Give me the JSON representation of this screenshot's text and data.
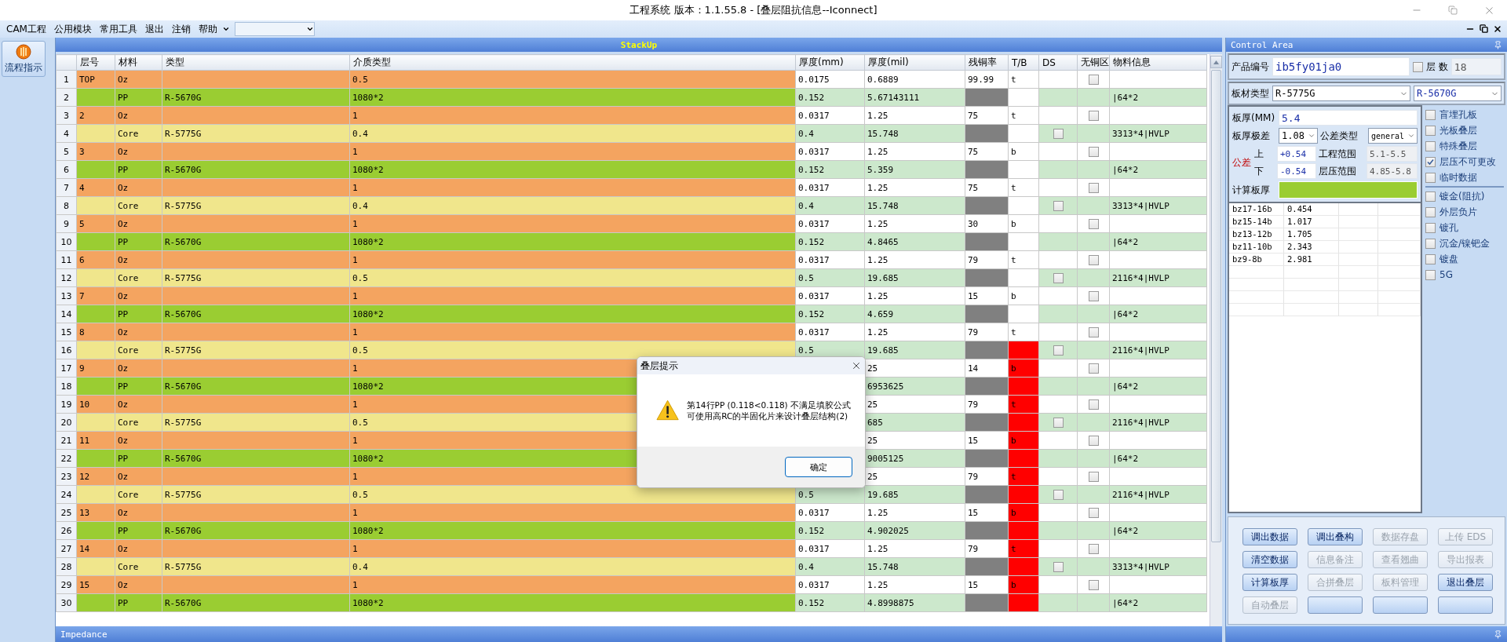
{
  "window": {
    "title": "工程系统   版本：1.1.55.8 - [叠层阻抗信息--Iconnect]"
  },
  "menu": {
    "items": [
      "CAM工程",
      "公用模块",
      "常用工具",
      "退出",
      "注销",
      "帮助"
    ]
  },
  "sidebar": {
    "items": [
      {
        "label": "流程指示",
        "selected": true
      }
    ]
  },
  "stackup": {
    "title": "StackUp",
    "columns": [
      "层号",
      "材料",
      "类型",
      "介质类型",
      "厚度(mm)",
      "厚度(mil)",
      "残铜率",
      "T/B",
      "DS",
      "无铜区",
      "物料信息"
    ],
    "rows": [
      {
        "n": "1",
        "kind": "copper",
        "layer": "TOP",
        "material": "Oz",
        "dielectric": "0.5",
        "mm": "0.0175",
        "mil": "0.6889",
        "cu": "99.99",
        "tb": "t",
        "tb_error": false,
        "cu_free": false
      },
      {
        "n": "2",
        "kind": "prepreg",
        "material": "PP",
        "type": "R-5670G",
        "dielectric": "1080*2",
        "mm": "0.152",
        "mil": "5.67143111",
        "tb_error": false,
        "info": "|64*2"
      },
      {
        "n": "3",
        "kind": "copper",
        "layer": "2",
        "material": "Oz",
        "dielectric": "1",
        "mm": "0.0317",
        "mil": "1.25",
        "cu": "75",
        "tb": "t",
        "tb_error": false,
        "cu_free": false
      },
      {
        "n": "4",
        "kind": "core",
        "material": "Core",
        "type": "R-5775G",
        "dielectric": "0.4",
        "mm": "0.4",
        "mil": "15.748",
        "tb_error": false,
        "ds": false,
        "info": "3313*4|HVLP"
      },
      {
        "n": "5",
        "kind": "copper",
        "layer": "3",
        "material": "Oz",
        "dielectric": "1",
        "mm": "0.0317",
        "mil": "1.25",
        "cu": "75",
        "tb": "b",
        "tb_error": false,
        "cu_free": false
      },
      {
        "n": "6",
        "kind": "prepreg",
        "material": "PP",
        "type": "R-5670G",
        "dielectric": "1080*2",
        "mm": "0.152",
        "mil": "5.359",
        "tb_error": false,
        "info": "|64*2"
      },
      {
        "n": "7",
        "kind": "copper",
        "layer": "4",
        "material": "Oz",
        "dielectric": "1",
        "mm": "0.0317",
        "mil": "1.25",
        "cu": "75",
        "tb": "t",
        "tb_error": false,
        "cu_free": false
      },
      {
        "n": "8",
        "kind": "core",
        "material": "Core",
        "type": "R-5775G",
        "dielectric": "0.4",
        "mm": "0.4",
        "mil": "15.748",
        "tb_error": false,
        "ds": false,
        "info": "3313*4|HVLP"
      },
      {
        "n": "9",
        "kind": "copper",
        "layer": "5",
        "material": "Oz",
        "dielectric": "1",
        "mm": "0.0317",
        "mil": "1.25",
        "cu": "30",
        "tb": "b",
        "tb_error": false,
        "cu_free": false
      },
      {
        "n": "10",
        "kind": "prepreg",
        "material": "PP",
        "type": "R-5670G",
        "dielectric": "1080*2",
        "mm": "0.152",
        "mil": "4.8465",
        "tb_error": false,
        "info": "|64*2"
      },
      {
        "n": "11",
        "kind": "copper",
        "layer": "6",
        "material": "Oz",
        "dielectric": "1",
        "mm": "0.0317",
        "mil": "1.25",
        "cu": "79",
        "tb": "t",
        "tb_error": false,
        "cu_free": false
      },
      {
        "n": "12",
        "kind": "core",
        "material": "Core",
        "type": "R-5775G",
        "dielectric": "0.5",
        "mm": "0.5",
        "mil": "19.685",
        "tb_error": false,
        "ds": false,
        "info": "2116*4|HVLP"
      },
      {
        "n": "13",
        "kind": "copper",
        "layer": "7",
        "material": "Oz",
        "dielectric": "1",
        "mm": "0.0317",
        "mil": "1.25",
        "cu": "15",
        "tb": "b",
        "tb_error": false,
        "cu_free": false
      },
      {
        "n": "14",
        "kind": "prepreg",
        "material": "PP",
        "type": "R-5670G",
        "dielectric": "1080*2",
        "mm": "0.152",
        "mil": "4.659",
        "tb_error": false,
        "info": "|64*2"
      },
      {
        "n": "15",
        "kind": "copper",
        "layer": "8",
        "material": "Oz",
        "dielectric": "1",
        "mm": "0.0317",
        "mil": "1.25",
        "cu": "79",
        "tb": "t",
        "tb_error": false,
        "cu_free": false
      },
      {
        "n": "16",
        "kind": "core",
        "material": "Core",
        "type": "R-5775G",
        "dielectric": "0.5",
        "mm": "0.5",
        "mil": "19.685",
        "tb_error": true,
        "ds": false,
        "info": "2116*4|HVLP"
      },
      {
        "n": "17",
        "kind": "copper",
        "layer": "9",
        "material": "Oz",
        "dielectric": "1",
        "mil": "25",
        "cu": "14",
        "tb": "b",
        "tb_error": true,
        "cu_free": false
      },
      {
        "n": "18",
        "kind": "prepreg",
        "material": "PP",
        "type": "R-5670G",
        "dielectric": "1080*2",
        "mil": "6953625",
        "tb_error": true,
        "info": "|64*2"
      },
      {
        "n": "19",
        "kind": "copper",
        "layer": "10",
        "material": "Oz",
        "dielectric": "1",
        "mil": "25",
        "cu": "79",
        "tb": "t",
        "tb_error": true,
        "cu_free": false
      },
      {
        "n": "20",
        "kind": "core",
        "material": "Core",
        "type": "R-5775G",
        "dielectric": "0.5",
        "mil": "685",
        "tb_error": true,
        "ds": false,
        "info": "2116*4|HVLP"
      },
      {
        "n": "21",
        "kind": "copper",
        "layer": "11",
        "material": "Oz",
        "dielectric": "1",
        "mil": "25",
        "cu": "15",
        "tb": "b",
        "tb_error": true,
        "cu_free": false
      },
      {
        "n": "22",
        "kind": "prepreg",
        "material": "PP",
        "type": "R-5670G",
        "dielectric": "1080*2",
        "mil": "9005125",
        "tb_error": true,
        "info": "|64*2"
      },
      {
        "n": "23",
        "kind": "copper",
        "layer": "12",
        "material": "Oz",
        "dielectric": "1",
        "mil": "25",
        "cu": "79",
        "tb": "t",
        "tb_error": true,
        "cu_free": false
      },
      {
        "n": "24",
        "kind": "core",
        "material": "Core",
        "type": "R-5775G",
        "dielectric": "0.5",
        "mm": "0.5",
        "mil": "19.685",
        "tb_error": true,
        "ds": false,
        "info": "2116*4|HVLP"
      },
      {
        "n": "25",
        "kind": "copper",
        "layer": "13",
        "material": "Oz",
        "dielectric": "1",
        "mm": "0.0317",
        "mil": "1.25",
        "cu": "15",
        "tb": "b",
        "tb_error": true,
        "cu_free": false
      },
      {
        "n": "26",
        "kind": "prepreg",
        "material": "PP",
        "type": "R-5670G",
        "dielectric": "1080*2",
        "mm": "0.152",
        "mil": "4.902025",
        "tb_error": true,
        "info": "|64*2"
      },
      {
        "n": "27",
        "kind": "copper",
        "layer": "14",
        "material": "Oz",
        "dielectric": "1",
        "mm": "0.0317",
        "mil": "1.25",
        "cu": "79",
        "tb": "t",
        "tb_error": true,
        "cu_free": false
      },
      {
        "n": "28",
        "kind": "core",
        "material": "Core",
        "type": "R-5775G",
        "dielectric": "0.4",
        "mm": "0.4",
        "mil": "15.748",
        "tb_error": true,
        "ds": false,
        "info": "3313*4|HVLP"
      },
      {
        "n": "29",
        "kind": "copper",
        "layer": "15",
        "material": "Oz",
        "dielectric": "1",
        "mm": "0.0317",
        "mil": "1.25",
        "cu": "15",
        "tb": "b",
        "tb_error": true,
        "cu_free": false
      },
      {
        "n": "30",
        "kind": "prepreg",
        "material": "PP",
        "type": "R-5670G",
        "dielectric": "1080*2",
        "mm": "0.152",
        "mil": "4.8998875",
        "tb_error": true,
        "info": "|64*2"
      }
    ]
  },
  "dialog": {
    "title": "叠层提示",
    "message": [
      "第14行PP (0.118<0.118) 不满足填胶公式",
      "可使用高RC的半固化片来设计叠层结构(2)"
    ],
    "button": "确定"
  },
  "impedance": {
    "title": "Impedance"
  },
  "control_area": {
    "title": "Control Area",
    "product_no": {
      "label": "产品编号",
      "value": "ib5fy01ja0"
    },
    "layer_count": {
      "label": "层 数",
      "checked": false,
      "value": "18"
    },
    "material": {
      "label": "板材类型",
      "core": "R-5775G",
      "prepreg": "R-5670G"
    },
    "thickness": {
      "label": "板厚(MM)",
      "value": "5.4"
    },
    "thickness_range": {
      "label": "板厚极差",
      "value": "1.08"
    },
    "tolerance_type": {
      "label": "公差类型",
      "value": "general"
    },
    "tolerance": {
      "label": "公差",
      "upper_label": "上",
      "upper": "+0.54",
      "lower_label": "下",
      "lower": "-0.54"
    },
    "eng_range": {
      "label": "工程范围",
      "value": "5.1-5.5"
    },
    "press_range": {
      "label": "层压范围",
      "value": "4.85-5.8"
    },
    "calc": {
      "label": "计算板厚"
    },
    "options": [
      [
        {
          "label": "盲埋孔板",
          "checked": false
        },
        {
          "label": "光板叠层",
          "checked": false
        },
        {
          "label": "特殊叠层",
          "checked": false
        },
        {
          "label": "层压不可更改",
          "checked": true
        },
        {
          "label": "临时数据",
          "checked": false
        }
      ],
      [
        {
          "label": "镀金(阻抗)",
          "checked": false
        },
        {
          "label": "外层负片",
          "checked": false
        },
        {
          "label": "镀孔",
          "checked": false
        },
        {
          "label": "沉金/镍钯金",
          "checked": false
        },
        {
          "label": "镀盘",
          "checked": false
        },
        {
          "label": "5G",
          "checked": false
        }
      ]
    ],
    "results": [
      {
        "name": "bz17-16b",
        "value": "0.454"
      },
      {
        "name": "bz15-14b",
        "value": "1.017"
      },
      {
        "name": "bz13-12b",
        "value": "1.705"
      },
      {
        "name": "bz11-10b",
        "value": "2.343"
      },
      {
        "name": "bz9-8b",
        "value": "2.981"
      }
    ],
    "buttons": [
      {
        "label": "调出数据",
        "disabled": false
      },
      {
        "label": "调出叠构",
        "disabled": false
      },
      {
        "label": "数据存盘",
        "disabled": true
      },
      {
        "label": "上传 EDS",
        "disabled": true
      },
      {
        "label": "清空数据",
        "disabled": false
      },
      {
        "label": "信息备注",
        "disabled": true
      },
      {
        "label": "查看翘曲",
        "disabled": true
      },
      {
        "label": "导出报表",
        "disabled": true
      },
      {
        "label": "计算板厚",
        "disabled": false
      },
      {
        "label": "合拼叠层",
        "disabled": true
      },
      {
        "label": "板料管理",
        "disabled": true
      },
      {
        "label": "退出叠层",
        "disabled": false
      },
      {
        "label": "自动叠层",
        "disabled": true
      },
      {
        "disabled": false
      },
      {
        "disabled": false
      },
      {
        "disabled": false
      }
    ]
  }
}
